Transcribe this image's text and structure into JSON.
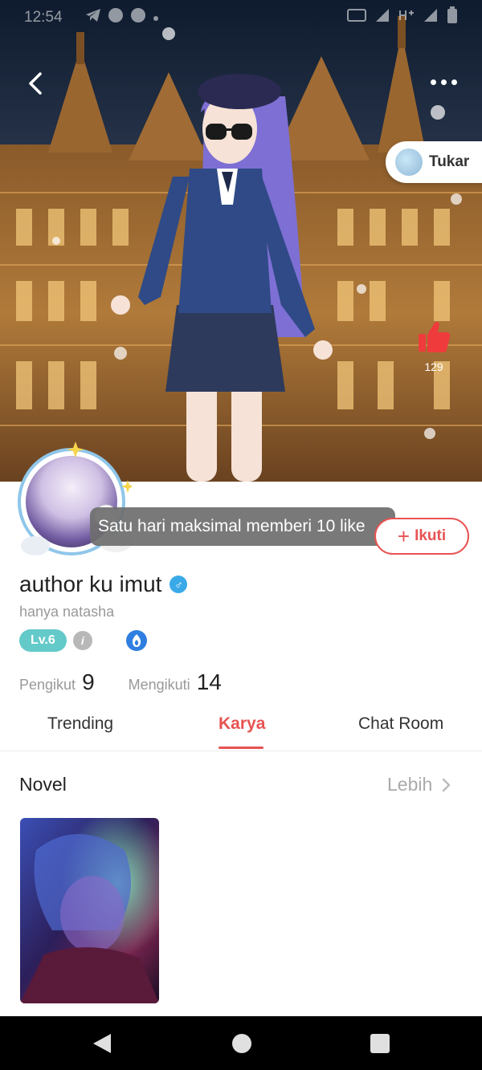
{
  "status_bar": {
    "time": "12:54",
    "icons": [
      "telegram-icon",
      "messenger-icon",
      "messenger-icon",
      "dot-icon"
    ],
    "right_icons": [
      "volte-icon",
      "signal-icon",
      "network-h-plus-icon",
      "signal-icon",
      "battery-icon"
    ]
  },
  "header": {
    "swap_label": "Tukar",
    "like_count": "129"
  },
  "profile": {
    "toast": "Satu hari maksimal memberi 10 like",
    "follow_label": "Ikuti",
    "username": "author ku imut",
    "gender_symbol": "♂",
    "subname": "hanya natasha",
    "level": "Lv.6",
    "info_symbol": "i",
    "followers_label": "Pengikut",
    "followers_count": "9",
    "following_label": "Mengikuti",
    "following_count": "14"
  },
  "tabs": [
    {
      "label": "Trending",
      "active": false
    },
    {
      "label": "Karya",
      "active": true
    },
    {
      "label": "Chat Room",
      "active": false
    }
  ],
  "novel_section": {
    "title": "Novel",
    "more_label": "Lebih"
  },
  "colors": {
    "accent": "#e85252",
    "level_badge": "#63c9c9",
    "gender": "#3aa9e8"
  }
}
